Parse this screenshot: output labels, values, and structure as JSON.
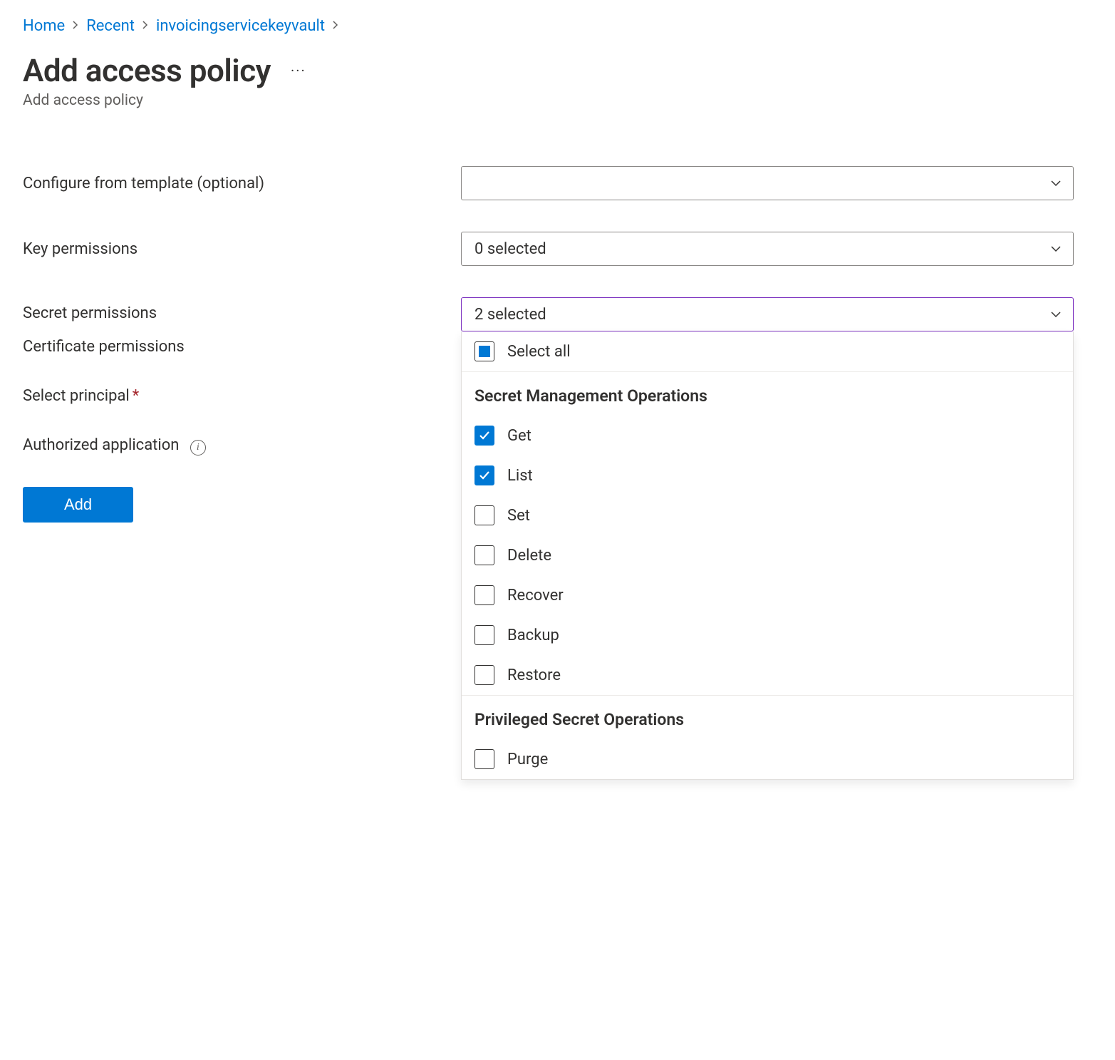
{
  "breadcrumb": {
    "items": [
      "Home",
      "Recent",
      "invoicingservicekeyvault"
    ]
  },
  "page": {
    "title": "Add access policy",
    "subtitle": "Add access policy"
  },
  "labels": {
    "template": "Configure from template (optional)",
    "key_perms": "Key permissions",
    "secret_perms": "Secret permissions",
    "cert_perms": "Certificate permissions",
    "principal": "Select principal",
    "authorized_app": "Authorized application",
    "add_button": "Add"
  },
  "selects": {
    "template_value": "",
    "key_perms_value": "0 selected",
    "secret_perms_value": "2 selected"
  },
  "dropdown": {
    "select_all": "Select all",
    "section1": "Secret Management Operations",
    "section2": "Privileged Secret Operations",
    "options": [
      {
        "label": "Get",
        "checked": true
      },
      {
        "label": "List",
        "checked": true
      },
      {
        "label": "Set",
        "checked": false
      },
      {
        "label": "Delete",
        "checked": false
      },
      {
        "label": "Recover",
        "checked": false
      },
      {
        "label": "Backup",
        "checked": false
      },
      {
        "label": "Restore",
        "checked": false
      }
    ],
    "privileged": [
      {
        "label": "Purge",
        "checked": false
      }
    ]
  },
  "colors": {
    "link": "#0078d4",
    "accent": "#0078d4",
    "active_border": "#7b2fbf",
    "required": "#a4262c"
  }
}
